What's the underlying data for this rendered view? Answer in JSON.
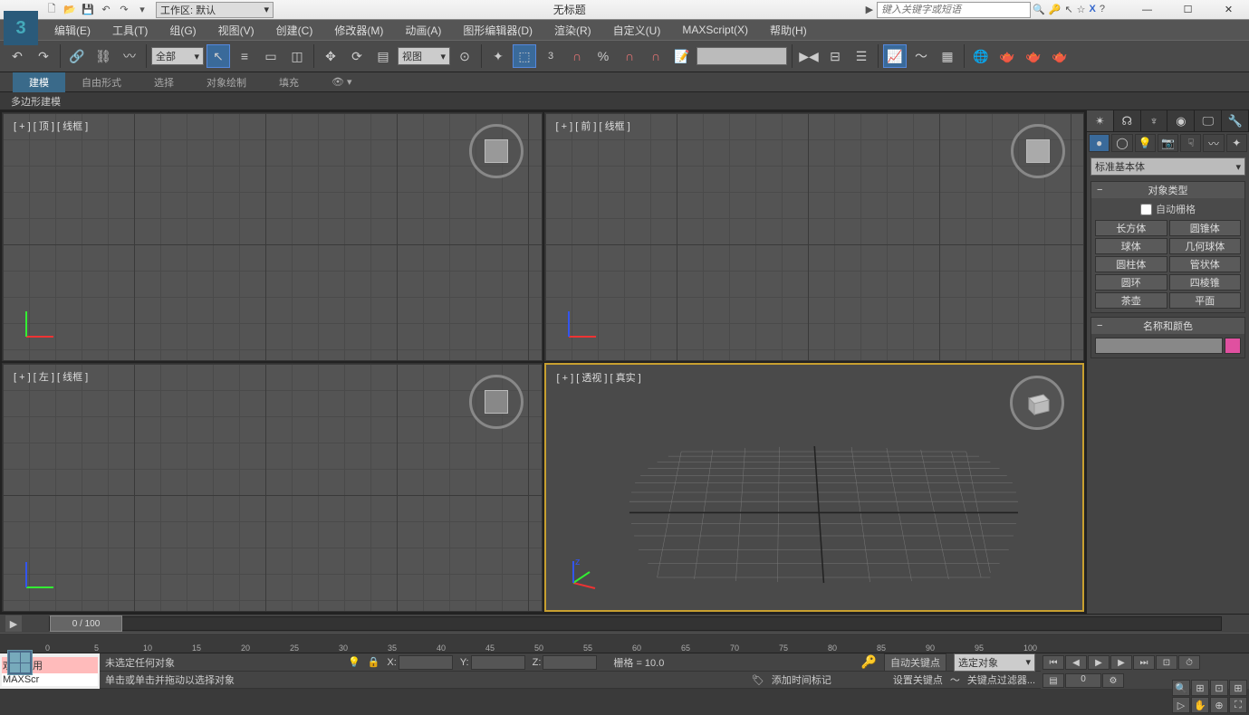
{
  "app": {
    "title": "无标题"
  },
  "workspace_label": "工作区: 默认",
  "search": {
    "placeholder": "键入关键字或短语"
  },
  "menu": [
    "编辑(E)",
    "工具(T)",
    "组(G)",
    "视图(V)",
    "创建(C)",
    "修改器(M)",
    "动画(A)",
    "图形编辑器(D)",
    "渲染(R)",
    "自定义(U)",
    "MAXScript(X)",
    "帮助(H)"
  ],
  "toolbar": {
    "selection_filter": "全部",
    "ref_coord": "视图",
    "angle_snap_val": "3"
  },
  "ribbon": {
    "tabs": [
      "建模",
      "自由形式",
      "选择",
      "对象绘制",
      "填充"
    ],
    "sub": "多边形建模"
  },
  "viewports": {
    "top": "[ + ] [ 顶 ]  [ 线框 ]",
    "front": "[ + ] [ 前 ]  [ 线框 ]",
    "left": "[ + ] [ 左 ]  [ 线框 ]",
    "persp": "[ + ] [ 透视 ]  [ 真实 ]"
  },
  "command_panel": {
    "category": "标准基本体",
    "rollout_objtype": "对象类型",
    "auto_grid": "自动栅格",
    "objects": [
      "长方体",
      "圆锥体",
      "球体",
      "几何球体",
      "圆柱体",
      "管状体",
      "圆环",
      "四棱锥",
      "茶壶",
      "平面"
    ],
    "rollout_name": "名称和颜色"
  },
  "timeline": {
    "slider": "0 / 100",
    "ticks": [
      "0",
      "5",
      "10",
      "15",
      "20",
      "25",
      "30",
      "35",
      "40",
      "45",
      "50",
      "55",
      "60",
      "65",
      "70",
      "75",
      "80",
      "85",
      "90",
      "95",
      "100"
    ]
  },
  "status": {
    "welcome_l1": "欢迎使用",
    "welcome_l2": "MAXScr",
    "sel": "未选定任何对象",
    "prompt": "单击或单击并拖动以选择对象",
    "x": "X:",
    "y": "Y:",
    "z": "Z:",
    "grid": "栅格 = 10.0",
    "add_time_tag": "添加时间标记",
    "autokey": "自动关键点",
    "setkey": "设置关键点",
    "sel_filter": "选定对象",
    "key_filter": "关键点过滤器...",
    "frame": "0"
  }
}
